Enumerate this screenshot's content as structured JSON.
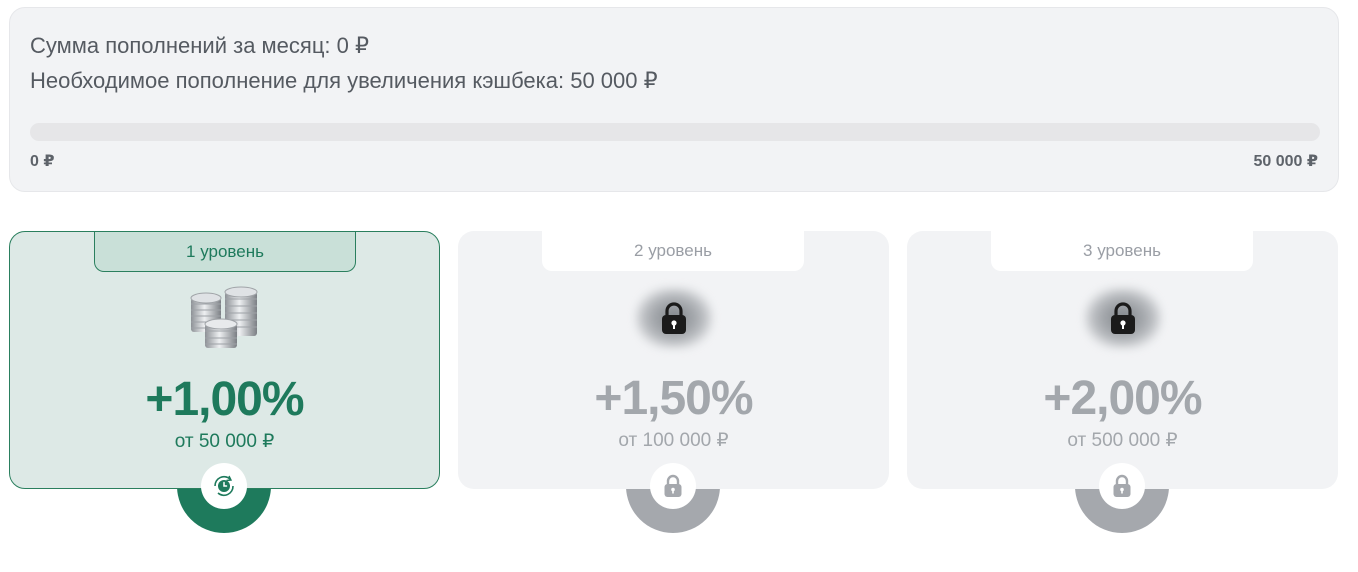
{
  "summary": {
    "month_total_label": "Сумма пополнений за месяц: 0 ₽",
    "required_label": "Необходимое пополнение для увеличения кэшбека: 50 000 ₽",
    "progress": {
      "fraction": 0,
      "min_label": "0 ₽",
      "max_label": "50 000 ₽"
    }
  },
  "levels": [
    {
      "tab": "1 уровень",
      "percent": "+1,00%",
      "threshold": "от 50 000 ₽",
      "status": "active",
      "icon": "coins-icon",
      "badge_icon": "clock-refresh-icon"
    },
    {
      "tab": "2 уровень",
      "percent": "+1,50%",
      "threshold": "от 100 000 ₽",
      "status": "locked",
      "icon": "lock-icon",
      "badge_icon": "lock-icon"
    },
    {
      "tab": "3 уровень",
      "percent": "+2,00%",
      "threshold": "от 500 000 ₽",
      "status": "locked",
      "icon": "lock-icon",
      "badge_icon": "lock-icon"
    }
  ],
  "colors": {
    "accent": "#1e7a5c",
    "active_card_bg": "#dde9e6",
    "locked_gray": "#a3a7ac"
  }
}
